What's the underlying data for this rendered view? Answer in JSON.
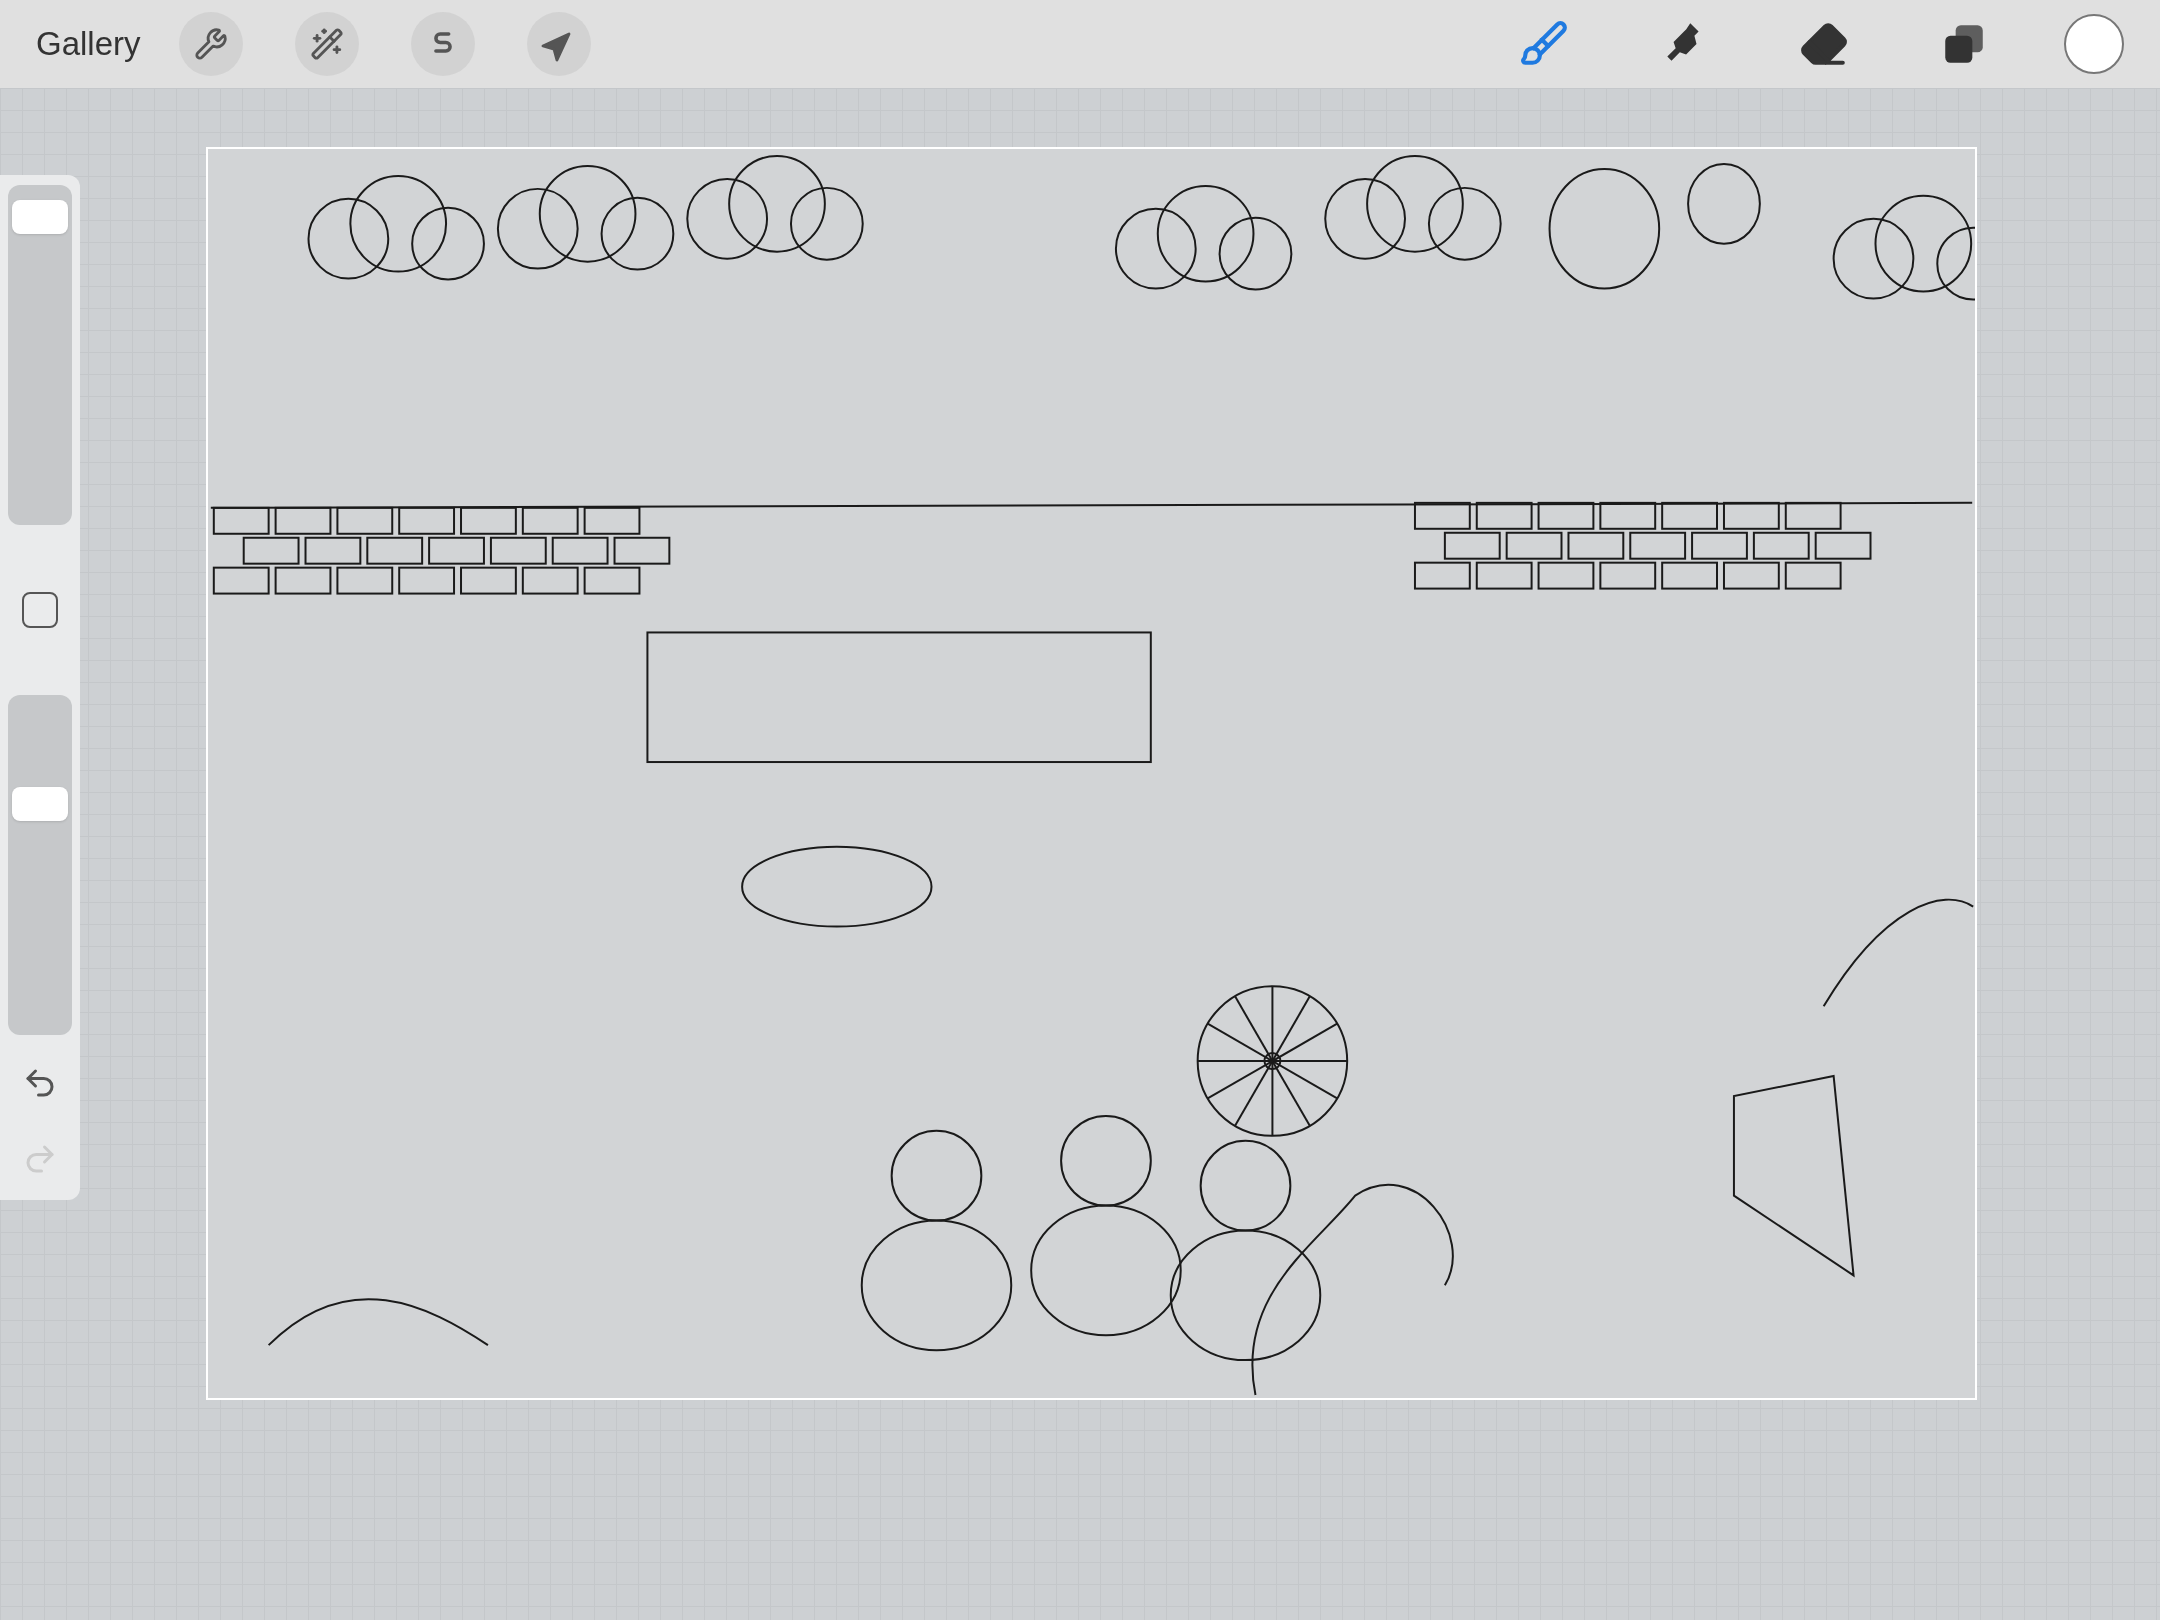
{
  "toolbar": {
    "gallery": "Gallery",
    "actions": [
      {
        "kind": "wrench"
      },
      {
        "kind": "magic"
      },
      {
        "kind": "selection"
      },
      {
        "kind": "transform"
      }
    ],
    "tools": [
      {
        "kind": "brush",
        "selected": true
      },
      {
        "kind": "smudge",
        "selected": false
      },
      {
        "kind": "eraser",
        "selected": false
      },
      {
        "kind": "layers",
        "selected": false
      }
    ],
    "color": "#ffffff"
  },
  "sidebar": {
    "size_slider": {
      "level": 0.95
    },
    "opacity_slider": {
      "level": 0.7
    },
    "undo": {
      "disabled": false
    },
    "redo": {
      "disabled": true
    }
  }
}
